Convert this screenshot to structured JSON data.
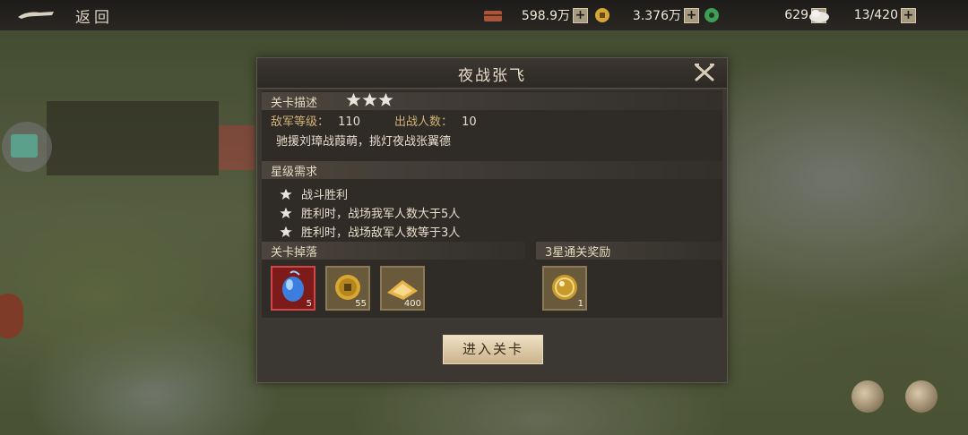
{
  "topbar": {
    "back_label": "返回",
    "resources": [
      {
        "name": "chest-icon",
        "value": "598.9万"
      },
      {
        "name": "copper-coin-icon",
        "value": "3.376万"
      },
      {
        "name": "jade-icon",
        "value": "629"
      },
      {
        "name": "troops-icon",
        "value": "13/420"
      }
    ],
    "plus_label": "+"
  },
  "dialog": {
    "title": "夜战张飞",
    "desc_header": "关卡描述",
    "star_rating": 3,
    "enemy_level_label": "敌军等级：",
    "enemy_level": "110",
    "deploy_label": "出战人数：",
    "deploy_count": "10",
    "description": "驰援刘璋战葭萌，挑灯夜战张翼德",
    "star_req_header": "星级需求",
    "requirements": [
      "战斗胜利",
      "胜利时，战场我军人数大于5人",
      "胜利时，战场敌军人数等于3人"
    ],
    "drops_header": "关卡掉落",
    "drops": [
      {
        "icon": "blue-gem-icon",
        "count": "5"
      },
      {
        "icon": "coin-icon",
        "count": "55"
      },
      {
        "icon": "gold-ingot-icon",
        "count": "400"
      }
    ],
    "reward_header": "3星通关奖励",
    "rewards": [
      {
        "icon": "gold-orb-icon",
        "count": "1"
      }
    ],
    "enter_label": "进入关卡"
  },
  "colors": {
    "accent_gold": "#d2b074",
    "star": "#e8e4dc",
    "button": "#e3d3b2"
  }
}
